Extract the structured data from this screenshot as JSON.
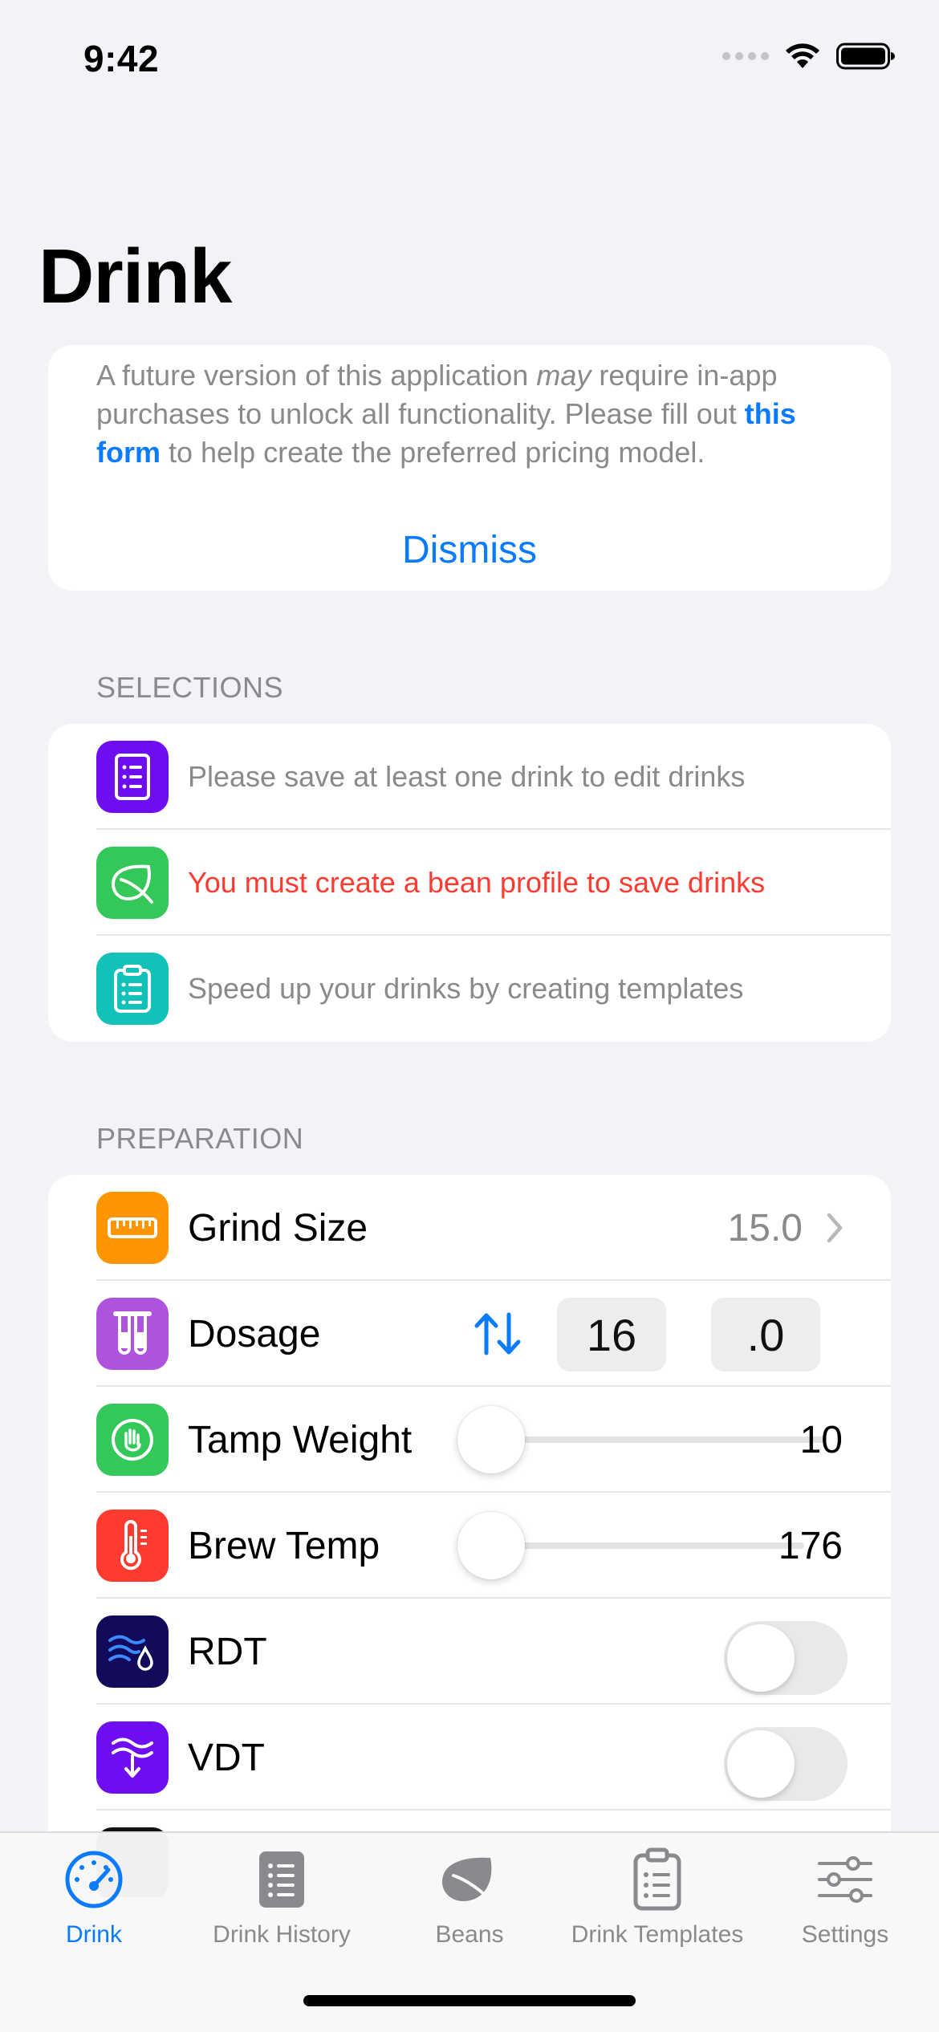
{
  "status_bar": {
    "time": "9:42"
  },
  "page": {
    "title": "Drink"
  },
  "notice": {
    "text_before_italic": "A future version of this application ",
    "text_italic": "may",
    "text_after_italic": " require in-app purchases to unlock all functionality. Please fill out ",
    "link_text": "this form",
    "text_end": " to help create the preferred pricing model.",
    "dismiss_label": "Dismiss"
  },
  "selections": {
    "header": "SELECTIONS",
    "items": [
      {
        "label": "Please save at least one drink to edit drinks",
        "icon": "list-icon",
        "color": "#6e0ef0",
        "emphasis": "muted"
      },
      {
        "label": "You must create a bean profile to save drinks",
        "icon": "leaf-icon",
        "color": "#34c759",
        "emphasis": "error"
      },
      {
        "label": "Speed up your drinks by creating templates",
        "icon": "clipboard-icon",
        "color": "#12c2b8",
        "emphasis": "muted"
      }
    ]
  },
  "preparation": {
    "header": "PREPARATION",
    "grind_size": {
      "label": "Grind Size",
      "value": "15.0",
      "icon": "ruler-icon",
      "color": "#ff9500"
    },
    "dosage": {
      "label": "Dosage",
      "whole": "16",
      "fraction": ".0",
      "icon": "test-tubes-icon",
      "color": "#af52de"
    },
    "tamp_weight": {
      "label": "Tamp Weight",
      "value": "10",
      "slider_level": 0,
      "icon": "hand-icon",
      "color": "#34c759"
    },
    "brew_temp": {
      "label": "Brew Temp",
      "value": "176",
      "slider_level": 0,
      "icon": "thermometer-icon",
      "color": "#ff3b30"
    },
    "rdt": {
      "label": "RDT",
      "enabled": false,
      "icon": "water-drop-icon",
      "color": "#120a5a"
    },
    "vdt": {
      "label": "VDT",
      "enabled": false,
      "icon": "wdt-icon",
      "color": "#6e0ef0"
    }
  },
  "tab_bar": {
    "tabs": [
      {
        "label": "Drink",
        "icon": "gauge-icon",
        "active": true
      },
      {
        "label": "Drink History",
        "icon": "list-icon",
        "active": false
      },
      {
        "label": "Beans",
        "icon": "leaf-icon",
        "active": false
      },
      {
        "label": "Drink Templates",
        "icon": "clipboard-icon",
        "active": false
      },
      {
        "label": "Settings",
        "icon": "sliders-icon",
        "active": false
      }
    ],
    "accent_color": "#0a7aff",
    "inactive_color": "#8a8a8e"
  }
}
